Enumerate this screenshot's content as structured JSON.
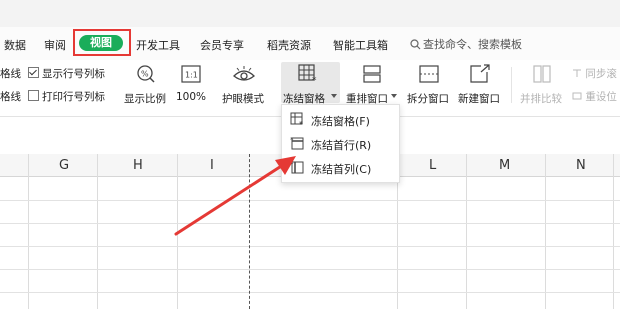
{
  "tabs": [
    "数据",
    "审阅",
    "视图",
    "开发工具",
    "会员专享",
    "稻壳资源",
    "智能工具箱"
  ],
  "active_tab": "视图",
  "search_placeholder": "查找命令、搜索模板",
  "ribbon": {
    "left_labels": [
      "格线",
      "格线"
    ],
    "checkboxes": [
      {
        "label": "显示行号列标",
        "checked": true
      },
      {
        "label": "打印行号列标",
        "checked": false
      }
    ],
    "buttons": [
      {
        "label": "显示比例",
        "icon": "zoom-icon"
      },
      {
        "label": "100%",
        "icon": "one-to-one-icon"
      },
      {
        "label": "护眼模式",
        "icon": "eye-icon"
      },
      {
        "label": "冻结窗格",
        "icon": "freeze-panes-icon",
        "dropdown": true
      },
      {
        "label": "重排窗口",
        "icon": "arrange-window-icon",
        "dropdown": true
      },
      {
        "label": "拆分窗口",
        "icon": "split-window-icon"
      },
      {
        "label": "新建窗口",
        "icon": "new-window-icon"
      },
      {
        "label": "并排比较",
        "icon": "side-by-side-icon",
        "disabled": true
      }
    ],
    "right_items": [
      {
        "label": "同步滚",
        "disabled": true
      },
      {
        "label": "重设位",
        "disabled": true
      }
    ]
  },
  "freeze_menu": [
    {
      "label": "冻结窗格(F)",
      "icon": "freeze-panes-icon"
    },
    {
      "label": "冻结首行(R)",
      "icon": "freeze-top-row-icon"
    },
    {
      "label": "冻结首列(C)",
      "icon": "freeze-first-column-icon"
    }
  ],
  "columns": [
    "G",
    "H",
    "I",
    "L",
    "M",
    "N"
  ],
  "colors": {
    "accent": "#1aad5a",
    "highlight": "#e53935"
  }
}
